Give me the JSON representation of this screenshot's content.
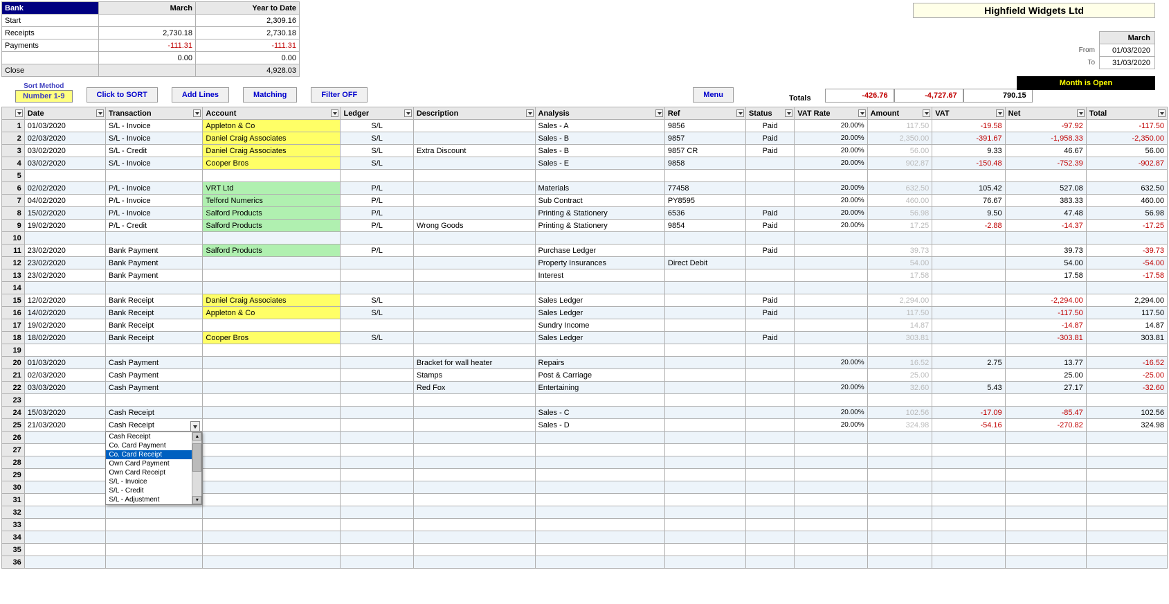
{
  "bank": {
    "title": "Bank",
    "cols": [
      "March",
      "Year to Date"
    ],
    "rows": [
      {
        "label": "Start",
        "march": "",
        "ytd": "2,309.16"
      },
      {
        "label": "Receipts",
        "march": "2,730.18",
        "ytd": "2,730.18"
      },
      {
        "label": "Payments",
        "march": "-111.31",
        "ytd": "-111.31",
        "neg": true
      },
      {
        "label": "",
        "march": "0.00",
        "ytd": "0.00"
      },
      {
        "label": "Close",
        "march": "",
        "ytd": "4,928.03",
        "gray": true
      }
    ]
  },
  "company": "Highfield Widgets Ltd",
  "period": {
    "header": "March",
    "from_label": "From",
    "from": "01/03/2020",
    "to_label": "To",
    "to": "31/03/2020"
  },
  "status": "Month  is  Open",
  "sort_method": {
    "label": "Sort Method",
    "value": "Number  1-9"
  },
  "buttons": {
    "sort": "Click to SORT",
    "add": "Add Lines",
    "match": "Matching",
    "filter": "Filter OFF",
    "menu": "Menu"
  },
  "totals": {
    "label": "Totals",
    "vat": "-426.76",
    "net": "-4,727.67",
    "total": "790.15"
  },
  "columns": [
    "",
    "Date",
    "Transaction",
    "Account",
    "Ledger",
    "Description",
    "Analysis",
    "Ref",
    "Status",
    "VAT Rate",
    "Amount",
    "VAT",
    "Net",
    "Total"
  ],
  "rows": [
    {
      "n": 1,
      "date": "01/03/2020",
      "txn": "S/L - Invoice",
      "acct": "Appleton & Co",
      "acls": "y",
      "ledger": "S/L",
      "desc": "",
      "analysis": "Sales - A",
      "ref": "9856",
      "status": "Paid",
      "vatrate": "20.00%",
      "amount": "117.50",
      "vat": "-19.58",
      "net": "-97.92",
      "total": "-117.50"
    },
    {
      "n": 2,
      "date": "02/03/2020",
      "txn": "S/L - Invoice",
      "acct": "Daniel Craig Associates",
      "acls": "y",
      "ledger": "S/L",
      "desc": "",
      "analysis": "Sales - B",
      "ref": "9857",
      "status": "Paid",
      "vatrate": "20.00%",
      "amount": "2,350.00",
      "vat": "-391.67",
      "net": "-1,958.33",
      "total": "-2,350.00"
    },
    {
      "n": 3,
      "date": "03/02/2020",
      "txn": "S/L - Credit",
      "acct": "Daniel Craig Associates",
      "acls": "y",
      "ledger": "S/L",
      "desc": "Extra Discount",
      "analysis": "Sales - B",
      "ref": "9857 CR",
      "status": "Paid",
      "vatrate": "20.00%",
      "amount": "56.00",
      "vat": "9.33",
      "net": "46.67",
      "total": "56.00"
    },
    {
      "n": 4,
      "date": "03/02/2020",
      "txn": "S/L - Invoice",
      "acct": "Cooper Bros",
      "acls": "y",
      "ledger": "S/L",
      "desc": "",
      "analysis": "Sales - E",
      "ref": "9858",
      "status": "",
      "vatrate": "20.00%",
      "amount": "902.87",
      "vat": "-150.48",
      "net": "-752.39",
      "total": "-902.87"
    },
    {
      "n": 5
    },
    {
      "n": 6,
      "date": "02/02/2020",
      "txn": "P/L - Invoice",
      "acct": "VRT Ltd",
      "acls": "g",
      "ledger": "P/L",
      "desc": "",
      "analysis": "Materials",
      "ref": "77458",
      "status": "",
      "vatrate": "20.00%",
      "amount": "632.50",
      "vat": "105.42",
      "net": "527.08",
      "total": "632.50"
    },
    {
      "n": 7,
      "date": "04/02/2020",
      "txn": "P/L - Invoice",
      "acct": "Telford Numerics",
      "acls": "g",
      "ledger": "P/L",
      "desc": "",
      "analysis": "Sub Contract",
      "ref": "PY8595",
      "status": "",
      "vatrate": "20.00%",
      "amount": "460.00",
      "vat": "76.67",
      "net": "383.33",
      "total": "460.00"
    },
    {
      "n": 8,
      "date": "15/02/2020",
      "txn": "P/L - Invoice",
      "acct": "Salford Products",
      "acls": "g",
      "ledger": "P/L",
      "desc": "",
      "analysis": "Printing & Stationery",
      "ref": "6536",
      "status": "Paid",
      "vatrate": "20.00%",
      "amount": "56.98",
      "vat": "9.50",
      "net": "47.48",
      "total": "56.98"
    },
    {
      "n": 9,
      "date": "19/02/2020",
      "txn": "P/L - Credit",
      "acct": "Salford Products",
      "acls": "g",
      "ledger": "P/L",
      "desc": "Wrong Goods",
      "analysis": "Printing & Stationery",
      "ref": "9854",
      "status": "Paid",
      "vatrate": "20.00%",
      "amount": "17.25",
      "vat": "-2.88",
      "net": "-14.37",
      "total": "-17.25"
    },
    {
      "n": 10
    },
    {
      "n": 11,
      "date": "23/02/2020",
      "txn": "Bank Payment",
      "acct": "Salford Products",
      "acls": "g",
      "ledger": "P/L",
      "desc": "",
      "analysis": "Purchase Ledger",
      "ref": "",
      "status": "Paid",
      "vatrate": "",
      "amount": "39.73",
      "vat": "",
      "net": "39.73",
      "total": "-39.73"
    },
    {
      "n": 12,
      "date": "23/02/2020",
      "txn": "Bank Payment",
      "acct": "",
      "ledger": "",
      "desc": "",
      "analysis": "Property Insurances",
      "ref": "Direct Debit",
      "status": "",
      "vatrate": "",
      "amount": "54.00",
      "vat": "",
      "net": "54.00",
      "total": "-54.00"
    },
    {
      "n": 13,
      "date": "23/02/2020",
      "txn": "Bank Payment",
      "acct": "",
      "ledger": "",
      "desc": "",
      "analysis": "Interest",
      "ref": "",
      "status": "",
      "vatrate": "",
      "amount": "17.58",
      "vat": "",
      "net": "17.58",
      "total": "-17.58"
    },
    {
      "n": 14
    },
    {
      "n": 15,
      "date": "12/02/2020",
      "txn": "Bank Receipt",
      "acct": "Daniel Craig Associates",
      "acls": "y",
      "ledger": "S/L",
      "desc": "",
      "analysis": "Sales Ledger",
      "ref": "",
      "status": "Paid",
      "vatrate": "",
      "amount": "2,294.00",
      "vat": "",
      "net": "-2,294.00",
      "total": "2,294.00"
    },
    {
      "n": 16,
      "date": "14/02/2020",
      "txn": "Bank Receipt",
      "acct": "Appleton & Co",
      "acls": "y",
      "ledger": "S/L",
      "desc": "",
      "analysis": "Sales Ledger",
      "ref": "",
      "status": "Paid",
      "vatrate": "",
      "amount": "117.50",
      "vat": "",
      "net": "-117.50",
      "total": "117.50"
    },
    {
      "n": 17,
      "date": "19/02/2020",
      "txn": "Bank Receipt",
      "acct": "",
      "ledger": "",
      "desc": "",
      "analysis": "Sundry Income",
      "ref": "",
      "status": "",
      "vatrate": "",
      "amount": "14.87",
      "vat": "",
      "net": "-14.87",
      "total": "14.87"
    },
    {
      "n": 18,
      "date": "18/02/2020",
      "txn": "Bank Receipt",
      "acct": "Cooper Bros",
      "acls": "y",
      "ledger": "S/L",
      "desc": "",
      "analysis": "Sales Ledger",
      "ref": "",
      "status": "Paid",
      "vatrate": "",
      "amount": "303.81",
      "vat": "",
      "net": "-303.81",
      "total": "303.81"
    },
    {
      "n": 19
    },
    {
      "n": 20,
      "date": "01/03/2020",
      "txn": "Cash Payment",
      "acct": "",
      "ledger": "",
      "desc": "Bracket for wall heater",
      "analysis": "Repairs",
      "ref": "",
      "status": "",
      "vatrate": "20.00%",
      "amount": "16.52",
      "vat": "2.75",
      "net": "13.77",
      "total": "-16.52"
    },
    {
      "n": 21,
      "date": "02/03/2020",
      "txn": "Cash Payment",
      "acct": "",
      "ledger": "",
      "desc": "Stamps",
      "analysis": "Post & Carriage",
      "ref": "",
      "status": "",
      "vatrate": "",
      "amount": "25.00",
      "vat": "",
      "net": "25.00",
      "total": "-25.00"
    },
    {
      "n": 22,
      "date": "03/03/2020",
      "txn": "Cash Payment",
      "acct": "",
      "ledger": "",
      "desc": "Red Fox",
      "analysis": "Entertaining",
      "ref": "",
      "status": "",
      "vatrate": "20.00%",
      "amount": "32.60",
      "vat": "5.43",
      "net": "27.17",
      "total": "-32.60"
    },
    {
      "n": 23
    },
    {
      "n": 24,
      "date": "15/03/2020",
      "txn": "Cash Receipt",
      "acct": "",
      "ledger": "",
      "desc": "",
      "analysis": "Sales - C",
      "ref": "",
      "status": "",
      "vatrate": "20.00%",
      "amount": "102.56",
      "vat": "-17.09",
      "net": "-85.47",
      "total": "102.56"
    },
    {
      "n": 25,
      "date": "21/03/2020",
      "txn": "Cash Receipt",
      "txn_dd": true,
      "acct": "",
      "ledger": "",
      "desc": "",
      "analysis": "Sales - D",
      "ref": "",
      "status": "",
      "vatrate": "20.00%",
      "amount": "324.98",
      "vat": "-54.16",
      "net": "-270.82",
      "total": "324.98"
    },
    {
      "n": 26
    },
    {
      "n": 27
    },
    {
      "n": 28
    },
    {
      "n": 29
    },
    {
      "n": 30
    },
    {
      "n": 31
    },
    {
      "n": 32
    },
    {
      "n": 33
    },
    {
      "n": 34
    },
    {
      "n": 35
    },
    {
      "n": 36
    }
  ],
  "dropdown": {
    "items": [
      "Cash Receipt",
      "Co. Card Payment",
      "Co. Card Receipt",
      "Own Card Payment",
      "Own Card Receipt",
      "S/L - Invoice",
      "S/L - Credit",
      "S/L - Adjustment"
    ],
    "selected_index": 2
  }
}
